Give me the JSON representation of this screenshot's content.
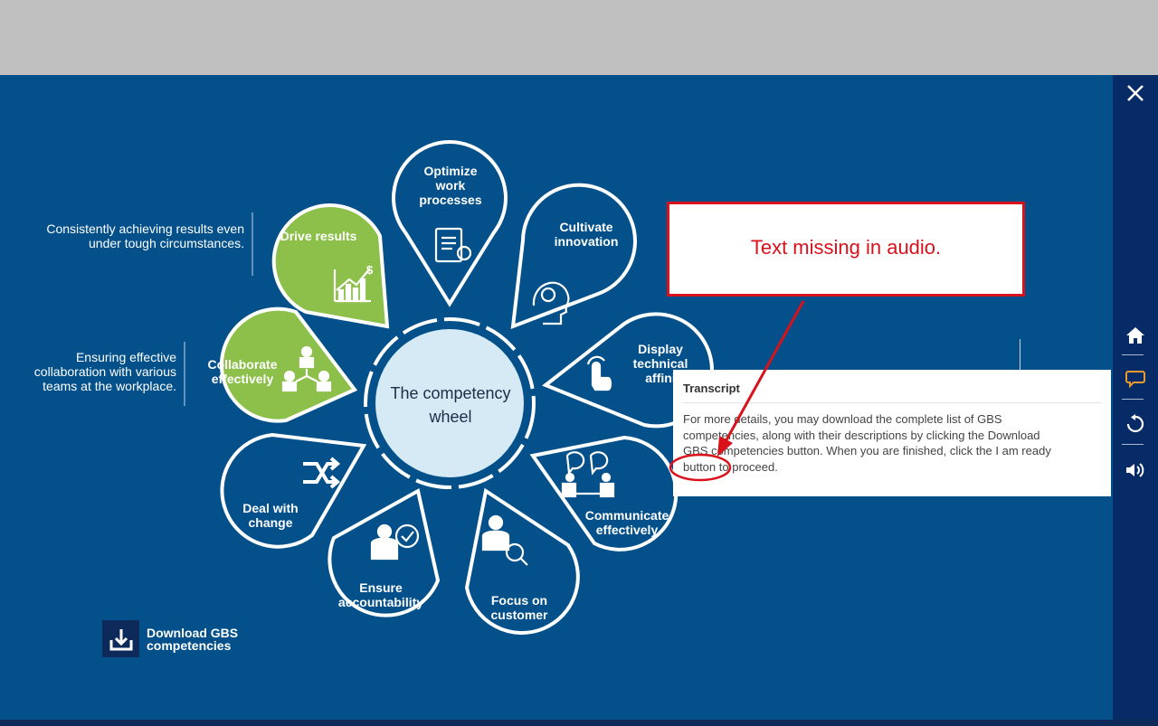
{
  "wheel": {
    "center_title": "The competency wheel",
    "petals": [
      {
        "id": "optimize",
        "label": "Optimize work processes",
        "lines": [
          "Optimize",
          "work",
          "processes"
        ]
      },
      {
        "id": "cultivate",
        "label": "Cultivate innovation",
        "lines": [
          "Cultivate",
          "innovation"
        ]
      },
      {
        "id": "display",
        "label": "Display technical affinity",
        "lines": [
          "Display",
          "technical",
          "affini"
        ]
      },
      {
        "id": "communicate",
        "label": "Communicate effectively",
        "lines": [
          "Communicate",
          "effectively"
        ]
      },
      {
        "id": "focus",
        "label": "Focus on customer",
        "lines": [
          "Focus on",
          "customer"
        ]
      },
      {
        "id": "ensure",
        "label": "Ensure accountability",
        "lines": [
          "Ensure",
          "accountability"
        ]
      },
      {
        "id": "deal",
        "label": "Deal with change",
        "lines": [
          "Deal with",
          "change"
        ]
      },
      {
        "id": "collaborate",
        "label": "Collaborate effectively",
        "lines": [
          "Collaborate",
          "effectively"
        ]
      },
      {
        "id": "drive",
        "label": "Drive results",
        "lines": [
          "Drive results"
        ]
      }
    ],
    "descriptions": {
      "drive": [
        "Consistently achieving results even",
        "under tough circumstances."
      ],
      "collaborate": [
        "Ensuring effective",
        "collaboration with various",
        "teams at the workplace."
      ]
    }
  },
  "download": {
    "line1": "Download GBS",
    "line2": "competencies"
  },
  "transcript": {
    "title": "Transcript",
    "lines": [
      "For more details, you may download the complete list of GBS",
      "competencies, along with their descriptions by clicking the Download",
      "GBS competencies button. When you are finished, click the I am ready",
      "button to proceed."
    ]
  },
  "annotation": {
    "text": "Text missing in audio."
  },
  "sidebar": {
    "close": "close-icon",
    "items": [
      "home-icon",
      "transcript-icon",
      "replay-icon",
      "volume-icon"
    ]
  },
  "colors": {
    "stage": "#03508a",
    "accent_green": "#8dc04a",
    "callout_red": "#d8111a",
    "hub": "#d5eaf5"
  }
}
